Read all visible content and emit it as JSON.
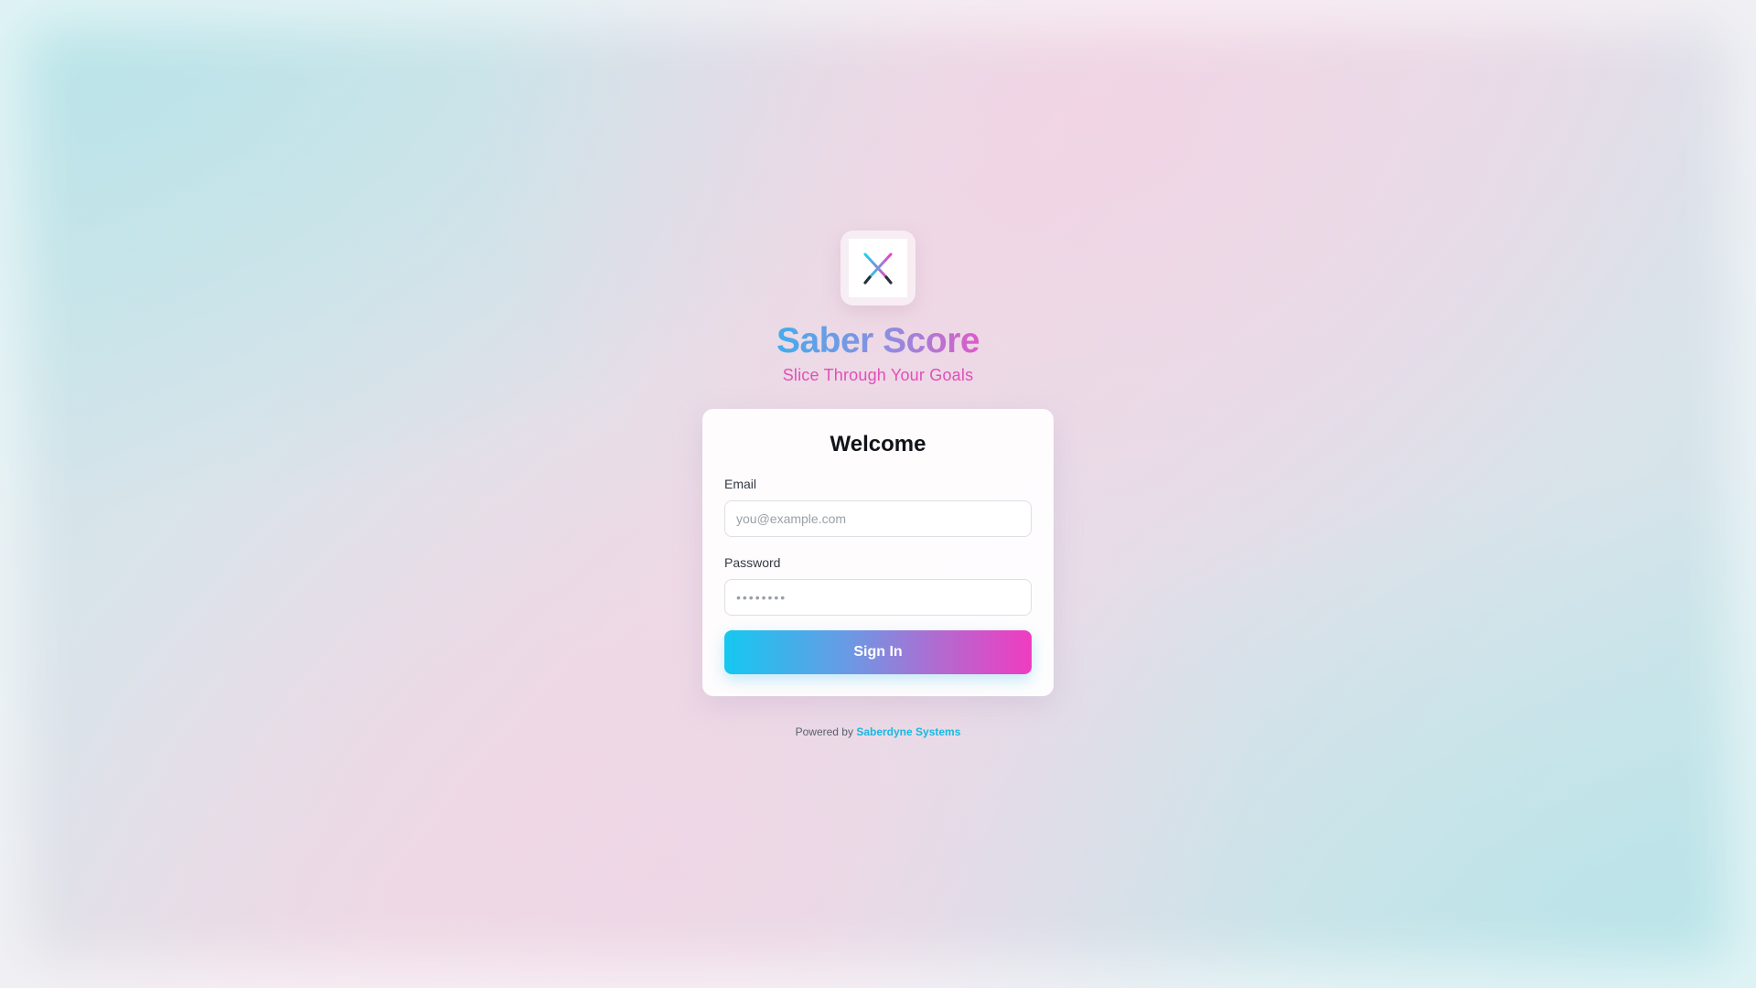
{
  "brand": {
    "title": "Saber Score",
    "tagline": "Slice Through Your Goals",
    "logo_icon": "crossed-sabers-icon"
  },
  "card": {
    "title": "Welcome",
    "email": {
      "label": "Email",
      "placeholder": "you@example.com",
      "value": ""
    },
    "password": {
      "label": "Password",
      "placeholder": "••••••••",
      "value": ""
    },
    "submit_label": "Sign In"
  },
  "footer": {
    "prefix": "Powered by",
    "link_text": "Saberdyne Systems"
  },
  "colors": {
    "accent_cyan": "#14c8f0",
    "accent_pink": "#f03cc0",
    "tagline_pink": "#e050b8",
    "link_cyan": "#17b9e0"
  }
}
